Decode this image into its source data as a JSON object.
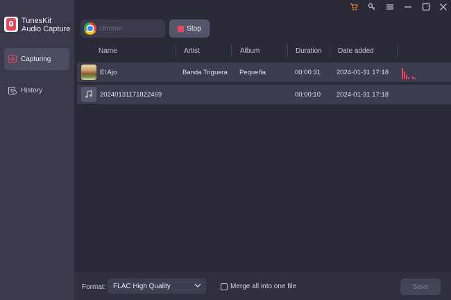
{
  "app": {
    "name_line1": "TunesKit",
    "name_line2": "Audio Capture"
  },
  "sidebar": {
    "items": [
      {
        "label": "Capturing",
        "icon": "capture-icon",
        "active": true
      },
      {
        "label": "History",
        "icon": "history-icon",
        "active": false
      }
    ]
  },
  "titlebar": {
    "icons": [
      "cart-icon",
      "key-icon",
      "menu-icon",
      "minimize-icon",
      "maximize-icon",
      "close-icon"
    ],
    "cart_color": "#e8833a"
  },
  "toolbar": {
    "source_label": "chrome",
    "stop_label": "Stop"
  },
  "table": {
    "columns": [
      "Name",
      "Artist",
      "Album",
      "Duration",
      "Date added"
    ],
    "rows": [
      {
        "name": "El Ajo",
        "artist": "Banda Triguera",
        "album": "Pequeña",
        "duration": "00:00:31",
        "date": "2024-01-31 17:18",
        "thumb": "album-art",
        "playing": true
      },
      {
        "name": "20240131171822469",
        "artist": "",
        "album": "",
        "duration": "00:00:10",
        "date": "2024-01-31 17:18",
        "thumb": "music-note-icon",
        "playing": false
      }
    ]
  },
  "footer": {
    "format_label": "Format:",
    "format_value": "FLAC High Quality",
    "merge_label": "Merge all into one file",
    "merge_checked": false,
    "save_label": "Save"
  },
  "colors": {
    "accent": "#e8465d",
    "background": "#2b2b38",
    "sidebar": "#3a3a4c"
  }
}
